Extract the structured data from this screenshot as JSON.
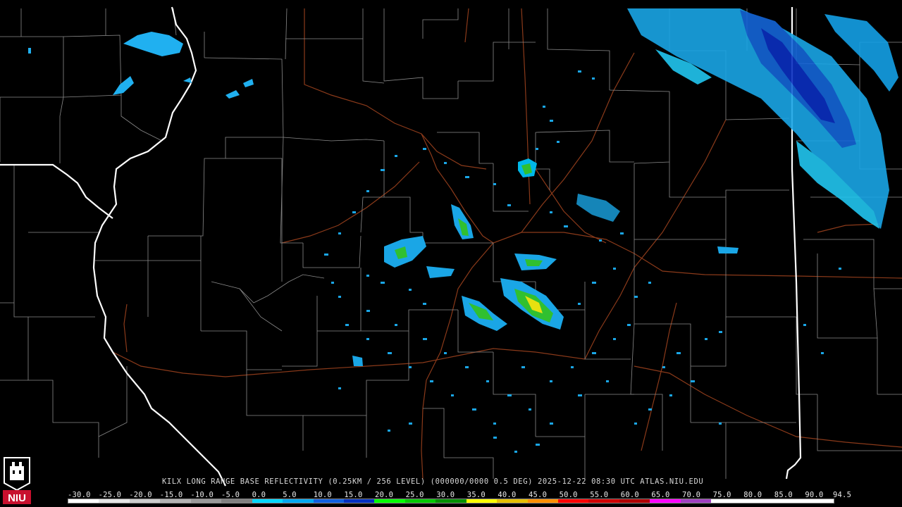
{
  "title": "KILX LONG RANGE BASE REFLECTIVITY (0.25KM / 256 LEVEL) (000000/0000 0.5 DEG) 2025-12-22 08:30 UTC  ATLAS.NIU.EDU",
  "logo": {
    "text": "NIU",
    "accent": "#c8102e"
  },
  "scale": {
    "labels": [
      "-30.0",
      "-25.0",
      "-20.0",
      "-15.0",
      "-10.0",
      "-5.0",
      "0.0",
      "5.0",
      "10.0",
      "15.0",
      "20.0",
      "25.0",
      "30.0",
      "35.0",
      "40.0",
      "45.0",
      "50.0",
      "55.0",
      "60.0",
      "65.0",
      "70.0",
      "75.0",
      "80.0",
      "85.0",
      "90.0",
      "94.5"
    ],
    "colors": [
      "#ffffff",
      "#e6e6e6",
      "#cccccc",
      "#b3b3b3",
      "#999999",
      "#808080",
      "#00d8ff",
      "#00a8f0",
      "#1060e0",
      "#0030c0",
      "#00ff00",
      "#00c800",
      "#009000",
      "#ffff00",
      "#e6c000",
      "#ff9000",
      "#ff0000",
      "#d00000",
      "#b00000",
      "#ff00ff",
      "#a040c0",
      "#ffffff",
      "#ffffff",
      "#ffffff",
      "#ffffff"
    ]
  },
  "map_colors": {
    "background": "#000000",
    "county_lines": "#8a8a8a",
    "state_lines": "#ffffff",
    "roads": "#8b3a1a"
  }
}
